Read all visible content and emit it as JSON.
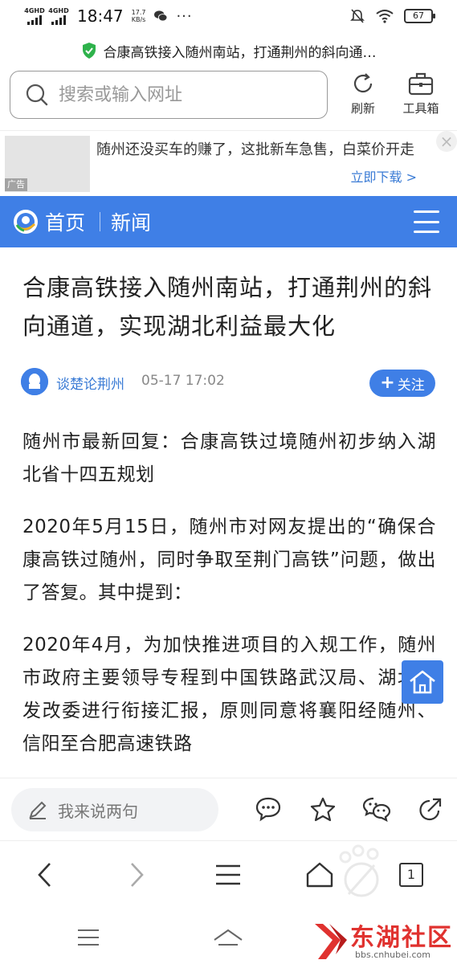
{
  "status_bar": {
    "signal1": "4GHD",
    "signal2": "4GHD",
    "time": "18:47",
    "speed_value": "17.7",
    "speed_unit": "KB/s",
    "more": "···",
    "battery": "67"
  },
  "page_title": "合康高铁接入随州南站，打通荆州的斜向通…",
  "address_bar": {
    "placeholder": "搜索或输入网址",
    "refresh_label": "刷新",
    "toolbox_label": "工具箱"
  },
  "ad": {
    "tag": "广告",
    "text": "随州还没买车的赚了，这批新车急售，白菜价开走",
    "cta": "立即下载 >"
  },
  "nav": {
    "home": "首页",
    "news": "新闻"
  },
  "article": {
    "title": "合康高铁接入随州南站，打通荆州的斜向通道，实现湖北利益最大化",
    "author": "谈楚论荆州",
    "time": "05-17 17:02",
    "follow": "关注",
    "paragraphs": [
      "随州市最新回复：合康高铁过境随州初步纳入湖北省十四五规划",
      "2020年5月15日，随州市对网友提出的“确保合康高铁过随州，同时争取至荆门高铁”问题，做出了答复。其中提到：",
      "2020年4月，为加快推进项目的入规工作，随州市政府主要领导专程到中国铁路武汉局、湖北省发改委进行衔接汇报，原则同意将襄阳经随州、信阳至合肥高速铁路"
    ]
  },
  "comment_bar": {
    "placeholder": "我来说两句"
  },
  "browser_nav": {
    "tab_count": "1"
  },
  "watermark": {
    "title": "东湖社区",
    "url": "bbs.cnhubei.com"
  },
  "colors": {
    "accent": "#3f7fe6",
    "link": "#3a7bd5",
    "watermark": "#e0322f"
  }
}
